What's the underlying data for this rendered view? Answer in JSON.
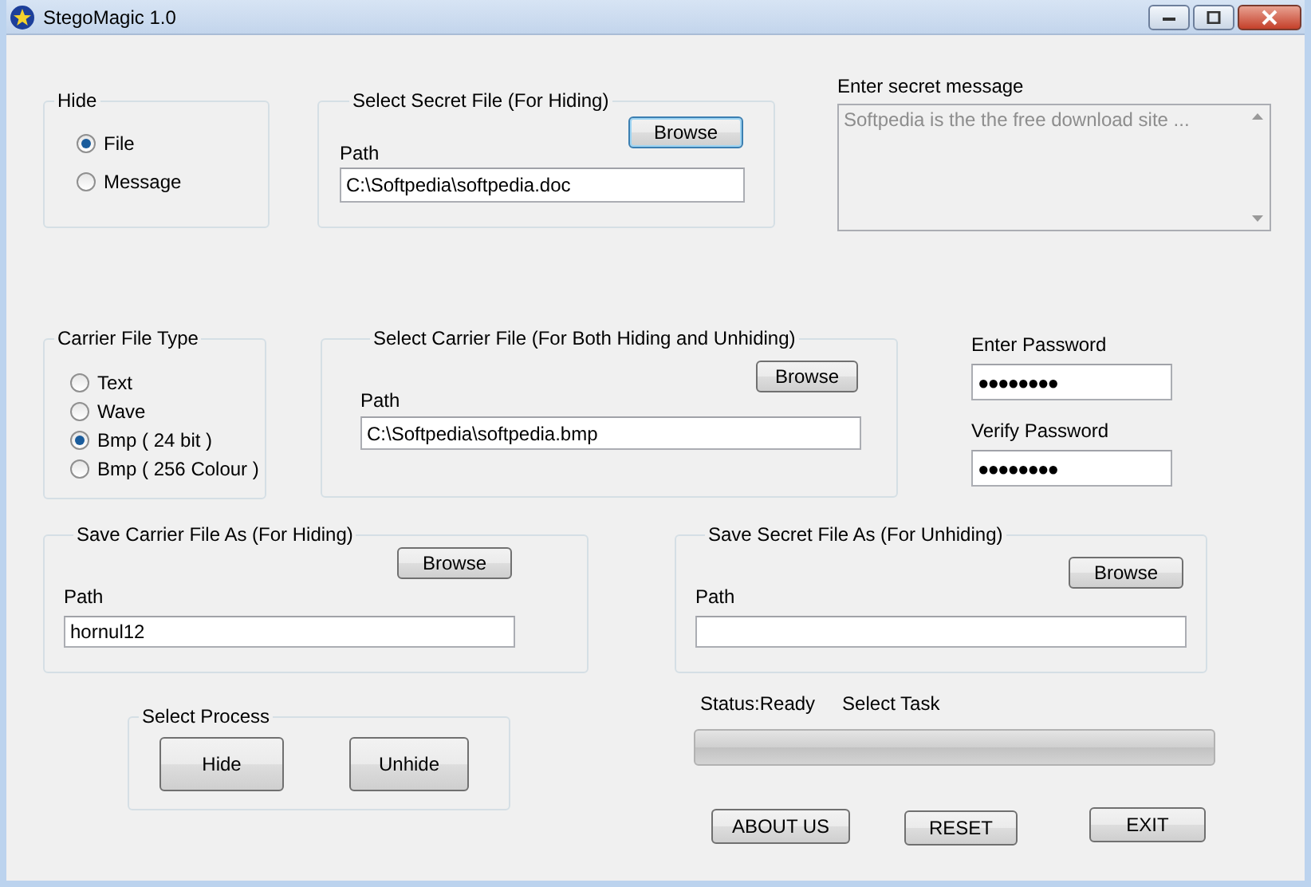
{
  "window": {
    "title": "StegoMagic 1.0"
  },
  "hide": {
    "title": "Hide",
    "options": [
      {
        "label": "File",
        "selected": true
      },
      {
        "label": "Message",
        "selected": false
      }
    ]
  },
  "secret_file": {
    "title": "Select Secret File (For Hiding)",
    "button": "Browse",
    "path_label": "Path",
    "path": "C:\\Softpedia\\softpedia.doc"
  },
  "secret_message": {
    "label": "Enter secret message",
    "value": "Softpedia is the the free download site ...",
    "disabled": true
  },
  "carrier_type": {
    "title": "Carrier File Type",
    "options": [
      {
        "label": "Text",
        "selected": false
      },
      {
        "label": "Wave",
        "selected": false
      },
      {
        "label": "Bmp ( 24 bit )",
        "selected": true
      },
      {
        "label": "Bmp ( 256 Colour )",
        "selected": false
      }
    ]
  },
  "carrier_file": {
    "title": "Select Carrier File (For Both Hiding and Unhiding)",
    "button": "Browse",
    "path_label": "Path",
    "path": "C:\\Softpedia\\softpedia.bmp"
  },
  "password": {
    "enter_label": "Enter Password",
    "enter_value": "●●●●●●●●",
    "verify_label": "Verify Password",
    "verify_value": "●●●●●●●●"
  },
  "save_carrier": {
    "title": "Save Carrier File As (For Hiding)",
    "button": "Browse",
    "path_label": "Path",
    "path": "hornul12"
  },
  "save_secret": {
    "title": "Save Secret File As (For Unhiding)",
    "button": "Browse",
    "path_label": "Path"
  },
  "process": {
    "title": "Select Process",
    "buttons": [
      "Hide",
      "Unhide"
    ]
  },
  "status": {
    "status": "Status:Ready",
    "task": "Select Task",
    "level": 0
  },
  "buttons": [
    "ABOUT US",
    "RESET",
    "EXIT"
  ]
}
